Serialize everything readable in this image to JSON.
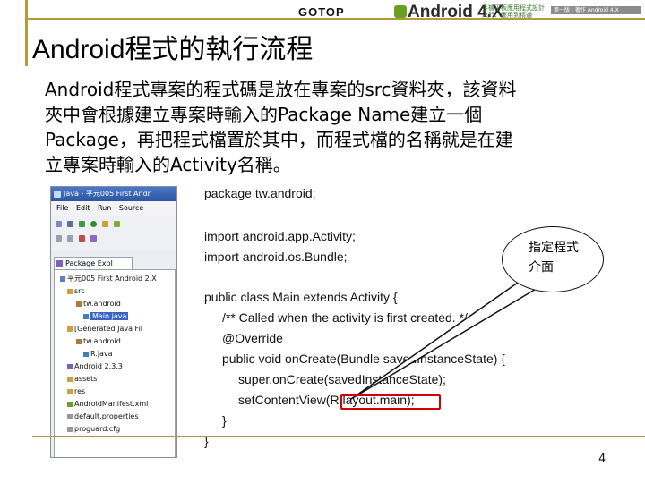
{
  "header": {
    "publisher": "GOTOP",
    "book_logo": "Android 4.X",
    "book_sub_line1": "手機平板應用程式設計",
    "book_sub_line2": "入門、應用到精通",
    "book_bar": "第一版 | 著作 Android 4.X"
  },
  "title": {
    "en": "Android",
    "zh": "程式的執行流程"
  },
  "intro": {
    "line1_a": "Android",
    "line1_b": "程式專案的程式碼是放在專案的",
    "line1_c": "src",
    "line1_d": "資料夾，該資料",
    "line2_a": "夾中會根據建立專案時輸入的",
    "line2_b": "Package Name",
    "line2_c": "建立一個",
    "line3_a": "Package",
    "line3_b": "，再把程式檔置於其中，而程式檔的名稱就是在建",
    "line4_a": "立專案時輸入的",
    "line4_b": "Activity",
    "line4_c": "名稱。"
  },
  "eclipse": {
    "window_title": "Java - 平元005 First Andr",
    "menus": [
      "File",
      "Edit",
      "Run",
      "Source"
    ],
    "view_tab": "Package Expl",
    "tree": [
      "平元005 First Android 2.X",
      "src",
      "tw.android",
      "Main.java",
      "[Generated Java Fil",
      "tw.android",
      "R.java",
      "Android 2.3.3",
      "assets",
      "res",
      "AndroidManifest.xml",
      "default.properties",
      "proguard.cfg"
    ]
  },
  "code": {
    "line1": "package tw.android;",
    "line2": "import android.app.Activity;",
    "line3": "import android.os.Bundle;",
    "line4": "public class Main extends Activity {",
    "line5": "/** Called when the activity is first created. */",
    "line6": "@Override",
    "line7": "public void onCreate(Bundle savedInstanceState) {",
    "line8": "super.onCreate(savedInstanceState);",
    "line9": "setContentView(R.layout.main);",
    "line10": "}",
    "line11": "}"
  },
  "callout": {
    "line1": "指定程式",
    "line2": "介面"
  },
  "page_number": "4",
  "colors": {
    "accent_gold": "#b59a3c",
    "highlight_red": "#d10000",
    "selection_blue": "#3a63c4"
  }
}
